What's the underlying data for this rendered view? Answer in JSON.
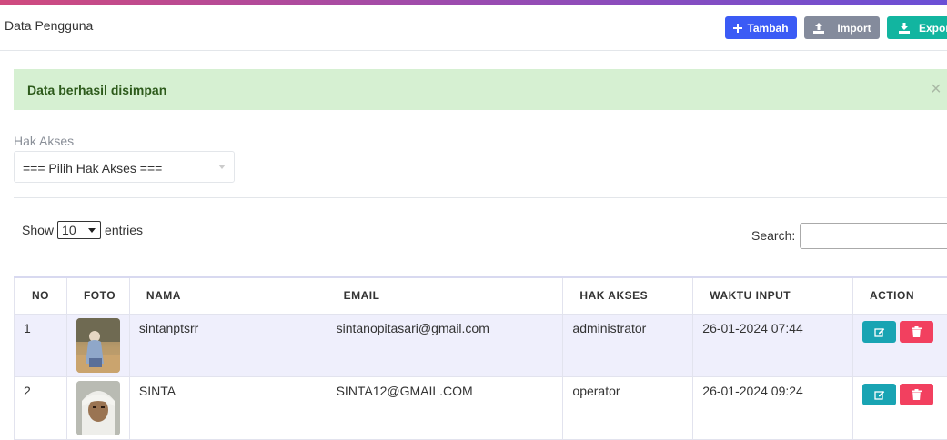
{
  "header": {
    "title": "Data Pengguna",
    "buttons": {
      "tambah": "Tambah",
      "import": "Import",
      "export": "Export"
    }
  },
  "alert": {
    "message": "Data berhasil disimpan",
    "close": "×"
  },
  "filter": {
    "label": "Hak Akses",
    "selected": "=== Pilih Hak Akses ==="
  },
  "datatable": {
    "show_label": "Show",
    "entries_label": "entries",
    "page_length": "10",
    "search_label": "Search:",
    "columns": [
      "NO",
      "FOTO",
      "NAMA",
      "EMAIL",
      "HAK AKSES",
      "WAKTU INPUT",
      "ACTION"
    ],
    "rows": [
      {
        "no": "1",
        "nama": "sintanptsrr",
        "email": "sintanopitasari@gmail.com",
        "hak_akses": "administrator",
        "waktu_input": "26-01-2024 07:44"
      },
      {
        "no": "2",
        "nama": "SINTA",
        "email": "SINTA12@GMAIL.COM",
        "hak_akses": "operator",
        "waktu_input": "26-01-2024 09:24"
      }
    ]
  },
  "colors": {
    "tambah": "#3b5bf5",
    "import": "#848b9c",
    "export": "#12b5a0",
    "alert_bg": "#d6f0d2",
    "edit": "#19a4b3",
    "delete": "#f2405f",
    "row_stripe": "#efeffc"
  },
  "icons": [
    "plus-icon",
    "upload-icon",
    "download-icon",
    "close-icon",
    "edit-icon",
    "trash-icon"
  ]
}
